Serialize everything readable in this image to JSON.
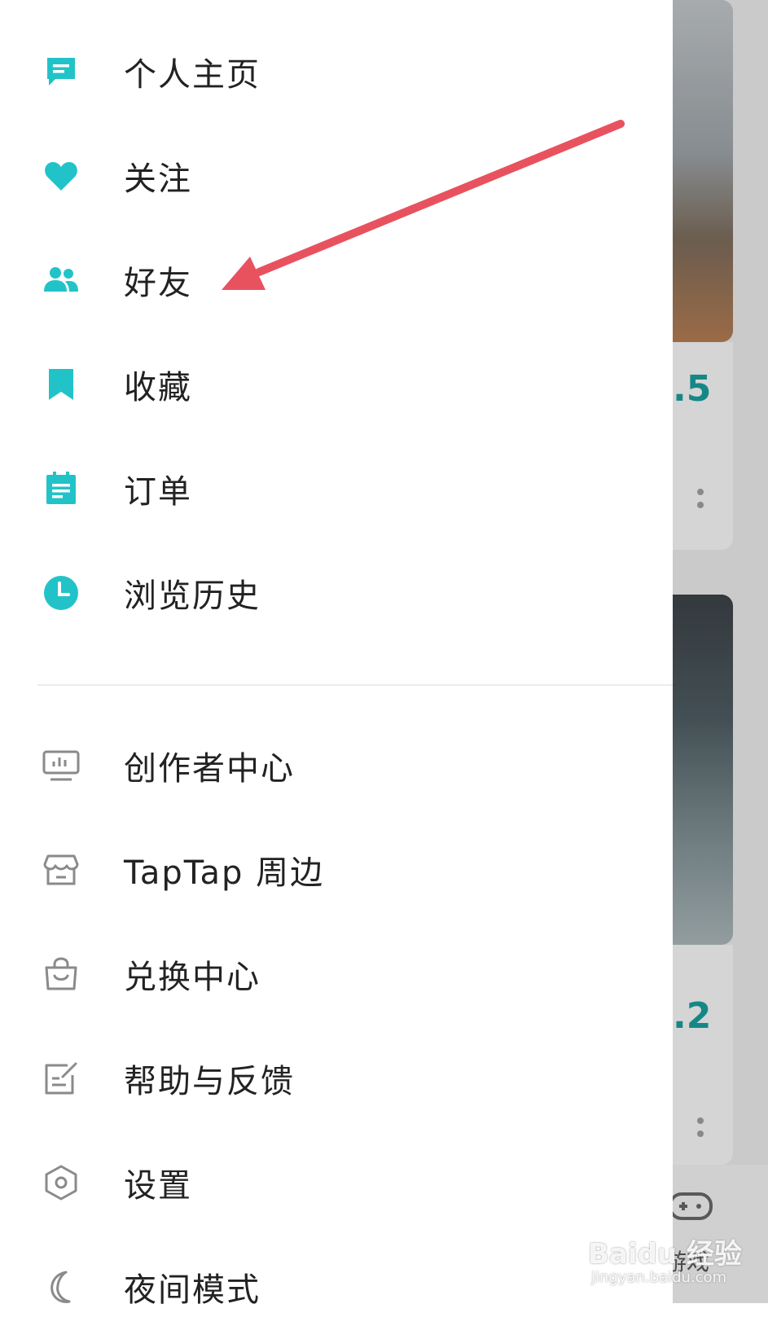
{
  "menu": {
    "primary": [
      {
        "label": "个人主页",
        "icon": "message-icon"
      },
      {
        "label": "关注",
        "icon": "heart-icon"
      },
      {
        "label": "好友",
        "icon": "friends-icon"
      },
      {
        "label": "收藏",
        "icon": "bookmark-icon"
      },
      {
        "label": "订单",
        "icon": "order-icon"
      },
      {
        "label": "浏览历史",
        "icon": "clock-icon"
      }
    ],
    "secondary": [
      {
        "label": "创作者中心",
        "icon": "monitor-chart-icon"
      },
      {
        "label": "TapTap 周边",
        "icon": "store-icon"
      },
      {
        "label": "兑换中心",
        "icon": "shopping-bag-icon"
      },
      {
        "label": "帮助与反馈",
        "icon": "edit-note-icon"
      },
      {
        "label": "设置",
        "icon": "settings-icon"
      },
      {
        "label": "夜间模式",
        "icon": "moon-icon"
      }
    ]
  },
  "background": {
    "card_scores": [
      ".5",
      ".2"
    ],
    "bottom_tab_label": "游戏"
  },
  "watermark": {
    "main": "Baidu 经验",
    "sub": "jingyan.baidu.com"
  },
  "colors": {
    "accent": "#22c3c8",
    "secondary_icon": "#8a8a8a",
    "arrow": "#e8525f",
    "score": "#1a9a9a"
  }
}
